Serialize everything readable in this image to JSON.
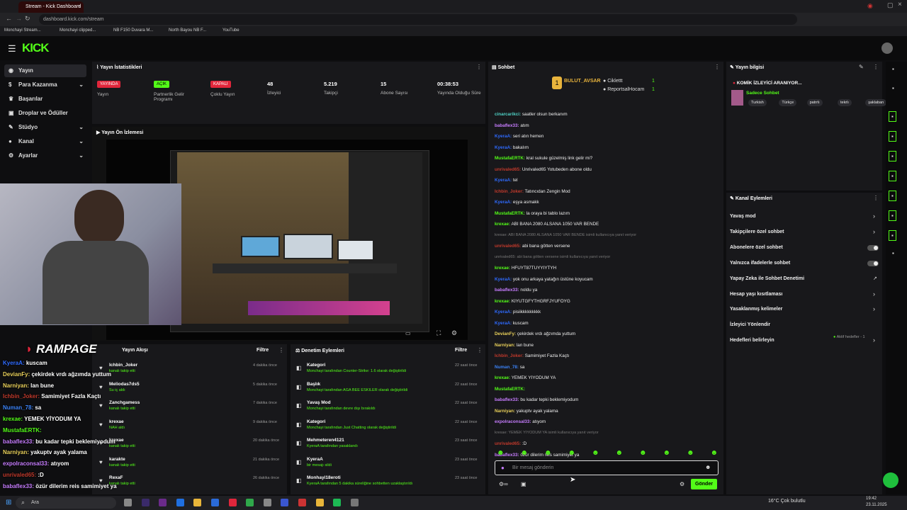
{
  "browser": {
    "tab_title": "Stream - Kick Dashboard",
    "url": "dashboard.kick.com/stream",
    "bookmarks": [
      "Monchayi Stream...",
      "Monchayi clipped...",
      "NB F150 Duvara M...",
      "North Bayou NB F...",
      "YouTube"
    ]
  },
  "brand": {
    "logo": "KICK",
    "accent": "#53fc18"
  },
  "sidebar": {
    "items": [
      {
        "label": "Yayın",
        "icon": "broadcast-icon"
      },
      {
        "label": "Para Kazanma",
        "icon": "dollar-icon"
      },
      {
        "label": "Başarılar",
        "icon": "trophy-icon"
      },
      {
        "label": "Droplar ve Ödüller",
        "icon": "gift-icon"
      },
      {
        "label": "Stüdyo",
        "icon": "brush-icon"
      },
      {
        "label": "Kanal",
        "icon": "user-icon"
      },
      {
        "label": "Ayarlar",
        "icon": "gear-icon"
      }
    ]
  },
  "stats": {
    "title": "Yayın İstatistikleri",
    "items": [
      {
        "badge": "YAYINDA",
        "badge_color": "#e0263b",
        "label": "Yayın"
      },
      {
        "badge": "AÇIK",
        "badge_color": "#53fc18",
        "label": "Partnerlik Gelir Programı"
      },
      {
        "badge": "KAPALI",
        "badge_color": "#e0263b",
        "label": "Çoklu Yayın"
      },
      {
        "value": "48",
        "label": "İzleyici"
      },
      {
        "value": "5.219",
        "label": "Takipçi"
      },
      {
        "value": "15",
        "label": "Abone Sayısı"
      },
      {
        "value": "00:38:53",
        "label": "Yayında Olduğu Süre"
      }
    ]
  },
  "preview": {
    "title": "Yayın Ön İzlemesi"
  },
  "overlay": {
    "brand": "RAMPAGE",
    "chat": [
      {
        "user": "KyeraA:",
        "text": "kuscam",
        "color": "#2f6bff"
      },
      {
        "user": "DevianFy:",
        "text": "çekirdek vrdı ağzımda yuttum",
        "color": "#e9d05a"
      },
      {
        "user": "Narniyan:",
        "text": "lan bune",
        "color": "#e9d05a"
      },
      {
        "user": "Ichbin_Joker:",
        "text": "Samimiyet Fazla Kaçtı",
        "color": "#c0392b"
      },
      {
        "user": "Numan_78:",
        "text": "sa",
        "color": "#3b82f6"
      },
      {
        "user": "krexae:",
        "text": "YEMEK YİYODUM YA",
        "color": "#53fc18"
      },
      {
        "user": "MustafaERTK:",
        "text": "",
        "color": "#53fc18"
      },
      {
        "user": "babaflex33:",
        "text": "bu kadar tepki beklemiyodum",
        "color": "#c77dff"
      },
      {
        "user": "Narniyan:",
        "text": "yakuptv ayak yalama",
        "color": "#e9d05a"
      },
      {
        "user": "expolraconsal33:",
        "text": "atıyom",
        "color": "#c77dff"
      },
      {
        "user": "unrivaled65:",
        "text": ":D",
        "color": "#c0392b"
      },
      {
        "user": "babaflex33:",
        "text": "özür dilerim reis samimiyet ya",
        "color": "#c77dff"
      }
    ]
  },
  "activity": {
    "title": "Yayın Akışı",
    "filter": "Filtre",
    "items": [
      {
        "name": "Ichbin_Joker",
        "sub": "kanalı takip etti",
        "ago": "4 dakika önce"
      },
      {
        "name": "Meliodas7ds5",
        "sub": "Su iç aldı",
        "ago": "5 dakika önce"
      },
      {
        "name": "Zanchgamess",
        "sub": "kanalı takip etti",
        "ago": "7 dakika önce"
      },
      {
        "name": "krexae",
        "sub": "NAH aldı",
        "ago": "9 dakika önce"
      },
      {
        "name": "krexae",
        "sub": "kanalı takip etti",
        "ago": "20 dakika önce"
      },
      {
        "name": "karakte",
        "sub": "kanalı takip etti",
        "ago": "21 dakika önce"
      },
      {
        "name": "RexaF",
        "sub": "kanalı takip etti",
        "ago": "26 dakika önce"
      }
    ]
  },
  "moderation": {
    "title": "Denetim Eylemleri",
    "filter": "Filtre",
    "items": [
      {
        "name": "Kategori",
        "sub": "Monchayi tarafından Counter-Strike: 1.6 olarak değiştirildi",
        "ago": "22 saat önce"
      },
      {
        "name": "Başlık",
        "sub": "Monchayi tarafından AGA BEE ESKİLER olarak değiştirildi",
        "ago": "22 saat önce"
      },
      {
        "name": "Yavaş Mod",
        "sub": "Monchayi tarafından devre dışı bırakıldı",
        "ago": "22 saat önce"
      },
      {
        "name": "Kategori",
        "sub": "Monchayi tarafından Just Chatting olarak değiştirildi",
        "ago": "22 saat önce"
      },
      {
        "name": "Mehmeteren4121",
        "sub": "KyeraA tarafından yasaklandı",
        "ago": "23 saat önce"
      },
      {
        "name": "KyeraA",
        "sub": "bir mesajı sildi",
        "ago": "23 saat önce"
      },
      {
        "name": "Monhayi18eroti",
        "sub": "KyeraA tarafından 5 dakika süreliğine sohbetten uzaklaştırıldı",
        "ago": "23 saat önce"
      }
    ]
  },
  "chat": {
    "title": "Sohbet",
    "pinned": [
      "BULUT_AVSAR",
      "Ciklettt",
      "ReportsalHocam"
    ],
    "pinned_counts": [
      "1",
      "1"
    ],
    "placeholder": "Bir mesaj gönderin",
    "send": "Gönder",
    "messages": [
      {
        "user": "cinarcarikci:",
        "text": "saatler olsun berkanım",
        "color": "#4fd1c5"
      },
      {
        "user": "babaflex33:",
        "text": "atım",
        "color": "#c77dff"
      },
      {
        "user": "KyeraA:",
        "text": "seri atın hemen",
        "color": "#2f6bff"
      },
      {
        "user": "KyeraA:",
        "text": "bakalım",
        "color": "#2f6bff"
      },
      {
        "user": "MustafaERTK:",
        "text": "kral sukule güzelmiş link gelir mi?",
        "color": "#53fc18"
      },
      {
        "user": "unrivaled65:",
        "text": "Unrivaled65 Yotubeden abone oldu",
        "color": "#c0392b"
      },
      {
        "user": "KyeraA:",
        "text": "tel",
        "color": "#2f6bff"
      },
      {
        "user": "Ichbin_Joker:",
        "text": "Tatıncıdan Zengin Mod",
        "color": "#c0392b"
      },
      {
        "user": "KyeraA:",
        "text": "eşya asmakk",
        "color": "#2f6bff"
      },
      {
        "user": "MustafaERTK:",
        "text": "la oraya bi tablo lazım",
        "color": "#53fc18"
      },
      {
        "user": "krexae:",
        "text": "ABİ BANA 2080 ALSANA 1050 VAR BENDE",
        "color": "#53fc18"
      },
      {
        "user": "",
        "text": "krexae: ABİ BANA 2080 ALSANA 1050 VAR BENDE isimli kullanıcıya yanıt veriyor",
        "color": "#777",
        "sys": true
      },
      {
        "user": "unrivaled65:",
        "text": "abi bana götten versene",
        "color": "#c0392b"
      },
      {
        "user": "",
        "text": "unrivaled65: abi bana götten versene isimli kullanıcıya yanıt veriyor",
        "color": "#777",
        "sys": true
      },
      {
        "user": "krexae:",
        "text": "HFUYT87TUYYIYTYH",
        "color": "#53fc18"
      },
      {
        "user": "KyeraA:",
        "text": "yok onu arkaya yatağın üstüne koyucam",
        "color": "#2f6bff"
      },
      {
        "user": "babaflex33:",
        "text": "noldu ya",
        "color": "#c77dff"
      },
      {
        "user": "krexae:",
        "text": "KIYUTGFYTHGRFJYUFÖYG",
        "color": "#53fc18"
      },
      {
        "user": "KyeraA:",
        "text": "pisiikkkkkkkkk",
        "color": "#2f6bff"
      },
      {
        "user": "KyeraA:",
        "text": "kuscam",
        "color": "#2f6bff"
      },
      {
        "user": "DevianFy:",
        "text": "çekirdek vrdı ağzımda yuttum",
        "color": "#e9d05a"
      },
      {
        "user": "Narniyan:",
        "text": "lan bune",
        "color": "#e9d05a"
      },
      {
        "user": "Ichbin_Joker:",
        "text": "Samimiyet Fazla Kaçtı",
        "color": "#c0392b"
      },
      {
        "user": "Numan_78:",
        "text": "sa",
        "color": "#3b82f6"
      },
      {
        "user": "krexae:",
        "text": "YEMEK YİYODUM YA",
        "color": "#53fc18"
      },
      {
        "user": "MustafaERTK:",
        "text": "",
        "color": "#53fc18"
      },
      {
        "user": "babaflex33:",
        "text": "bu kadar tepki beklemiyodum",
        "color": "#c77dff"
      },
      {
        "user": "Narniyan:",
        "text": "yakuptv ayak yalama",
        "color": "#e9d05a"
      },
      {
        "user": "expolraconsal33:",
        "text": "atıyom",
        "color": "#c77dff"
      },
      {
        "user": "",
        "text": "krexae: YEMEK YİYODUM YA isimli kullanıcıya yanıt veriyor",
        "color": "#777",
        "sys": true
      },
      {
        "user": "unrivaled65:",
        "text": ":D",
        "color": "#c0392b"
      },
      {
        "user": "babaflex33:",
        "text": "özür dilerim reis samimiyet ya",
        "color": "#c77dff"
      }
    ]
  },
  "info": {
    "title": "Yayın bilgisi",
    "stream_title": "KOMİK İZLEYİCİ ARANIYOR...",
    "category": "Sadece Sohbet",
    "tags": [
      "Turkish",
      "Türkçe",
      "patrrlı",
      "tekrlı",
      "şaklaban",
      "şikrrt"
    ]
  },
  "channel_actions": {
    "title": "Kanal Eylemleri",
    "items": [
      {
        "label": "Yavaş mod",
        "ctrl": "arrow"
      },
      {
        "label": "Takipçilere özel sohbet",
        "ctrl": "arrow"
      },
      {
        "label": "Abonelere özel sohbet",
        "ctrl": "toggle"
      },
      {
        "label": "Yalnızca ifadelerle sohbet",
        "ctrl": "toggle"
      },
      {
        "label": "Yapay Zeka ile Sohbet Denetimi",
        "ctrl": "link"
      },
      {
        "label": "Hesap yaşı kısıtlaması",
        "ctrl": "arrow"
      },
      {
        "label": "Yasaklanmış kelimeler",
        "ctrl": "arrow"
      },
      {
        "label": "İzleyici Yönlendir",
        "ctrl": "none"
      },
      {
        "label": "Hedefleri belirleyin",
        "ctrl": "arrow"
      }
    ],
    "goals_note": "Aktif hedefler - 1"
  },
  "taskbar": {
    "search": "Ara",
    "weather": "16°C  Çok bulutlu",
    "time": "19:42",
    "date": "23.11.2025"
  }
}
